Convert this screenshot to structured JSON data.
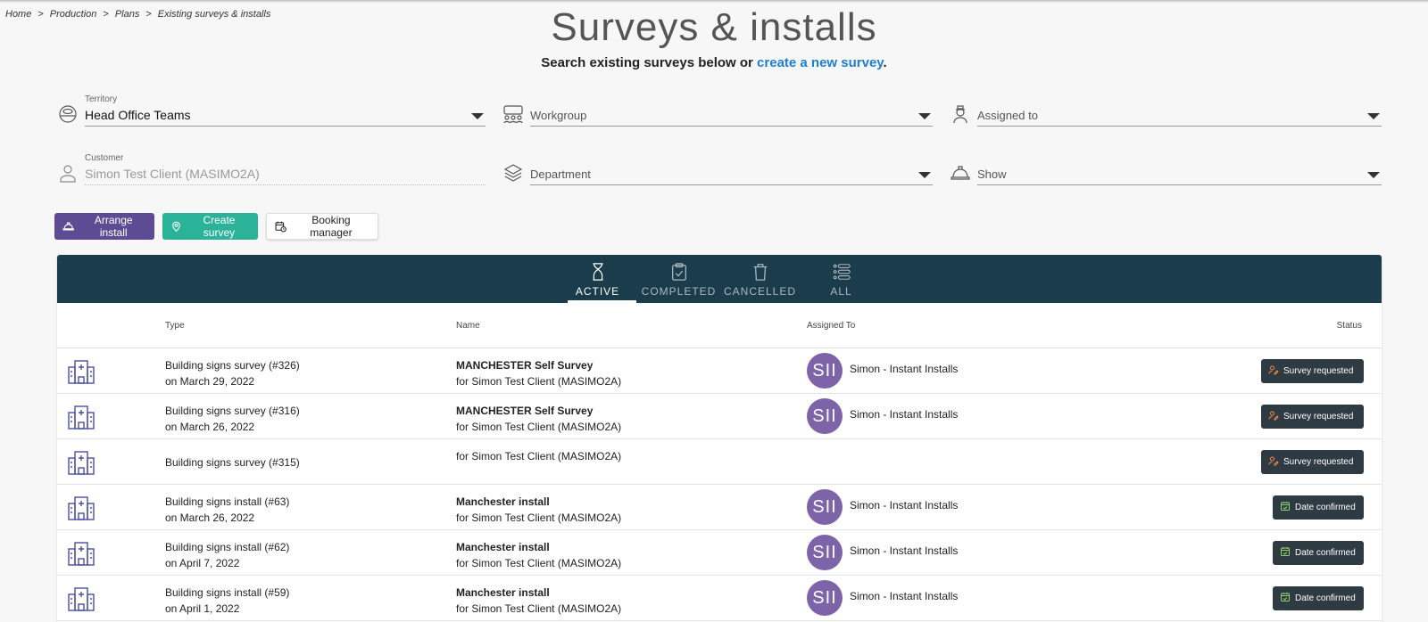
{
  "breadcrumb": [
    "Home",
    "Production",
    "Plans",
    "Existing surveys & installs"
  ],
  "page": {
    "title": "Surveys & installs",
    "subtitle_prefix": "Search existing surveys below or ",
    "subtitle_link": "create a new survey",
    "subtitle_suffix": "."
  },
  "filters": {
    "territory": {
      "label": "Territory",
      "value": "Head Office Teams"
    },
    "workgroup": {
      "placeholder": "Workgroup"
    },
    "assigned_to": {
      "placeholder": "Assigned to"
    },
    "customer": {
      "label": "Customer",
      "value": "Simon Test Client (MASIMO2A)"
    },
    "department": {
      "placeholder": "Department"
    },
    "show": {
      "placeholder": "Show"
    }
  },
  "actions": {
    "arrange_install": "Arrange install",
    "create_survey": "Create survey",
    "booking_manager": "Booking manager"
  },
  "tabs": [
    {
      "label": "ACTIVE",
      "icon": "hourglass-icon",
      "active": true
    },
    {
      "label": "COMPLETED",
      "icon": "clipboard-check-icon",
      "active": false
    },
    {
      "label": "CANCELLED",
      "icon": "trash-icon",
      "active": false
    },
    {
      "label": "ALL",
      "icon": "list-icon",
      "active": false
    }
  ],
  "table": {
    "headers": {
      "type": "Type",
      "name": "Name",
      "assigned": "Assigned To",
      "status": "Status"
    },
    "rows": [
      {
        "type": "Building signs survey (#326)",
        "date": "on March 29, 2022",
        "name": "MANCHESTER Self Survey",
        "for": "for Simon Test Client (MASIMO2A)",
        "avatar": "SII",
        "assignee": "Simon - Instant Installs",
        "status": "Survey requested",
        "status_kind": "req"
      },
      {
        "type": "Building signs survey (#316)",
        "date": "on March 26, 2022",
        "name": "MANCHESTER Self Survey",
        "for": "for Simon Test Client (MASIMO2A)",
        "avatar": "SII",
        "assignee": "Simon - Instant Installs",
        "status": "Survey requested",
        "status_kind": "req"
      },
      {
        "type": "Building signs survey (#315)",
        "date": "",
        "name": "",
        "for": "for Simon Test Client (MASIMO2A)",
        "avatar": "",
        "assignee": "",
        "status": "Survey requested",
        "status_kind": "req"
      },
      {
        "type": "Building signs install (#63)",
        "date": "on March 26, 2022",
        "name": "Manchester install",
        "for": "for Simon Test Client (MASIMO2A)",
        "avatar": "SII",
        "assignee": "Simon - Instant Installs",
        "status": "Date confirmed",
        "status_kind": "conf"
      },
      {
        "type": "Building signs install (#62)",
        "date": "on April 7, 2022",
        "name": "Manchester install",
        "for": "for Simon Test Client (MASIMO2A)",
        "avatar": "SII",
        "assignee": "Simon - Instant Installs",
        "status": "Date confirmed",
        "status_kind": "conf"
      },
      {
        "type": "Building signs install (#59)",
        "date": "on April 1, 2022",
        "name": "Manchester install",
        "for": "for Simon Test Client (MASIMO2A)",
        "avatar": "SII",
        "assignee": "Simon - Instant Installs",
        "status": "Date confirmed",
        "status_kind": "conf"
      }
    ]
  },
  "colors": {
    "accent_link": "#1c7ed6",
    "tabbar": "#1a3c4b",
    "purple": "#5d4b93",
    "teal": "#2bb39a",
    "avatar": "#7d63a8",
    "status_bg": "#2f3b43"
  }
}
